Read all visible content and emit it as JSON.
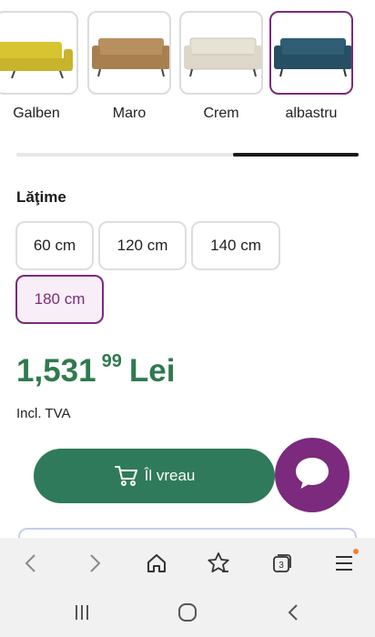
{
  "colors": {
    "accent": "#7b2a7d",
    "price_green": "#2f7a4f",
    "button_green": "#2f7a5a"
  },
  "color_options": [
    {
      "label": "Galben",
      "sofa_color": "#d8c431",
      "selected": false
    },
    {
      "label": "Maro",
      "sofa_color": "#b8905f",
      "selected": false
    },
    {
      "label": "Crem",
      "sofa_color": "#e6e2d6",
      "selected": false
    },
    {
      "label": "albastru",
      "sofa_color": "#2f5d75",
      "selected": true
    }
  ],
  "width_section": {
    "title": "Lăţime",
    "options": [
      "60 cm",
      "120 cm",
      "140 cm",
      "180 cm"
    ],
    "selected": "180 cm"
  },
  "price": {
    "main": "1,531",
    "cents": "99",
    "currency": "Lei",
    "vat_note": "Incl. TVA"
  },
  "buy_button": {
    "label": "Îl vreau",
    "icon": "cart-icon"
  },
  "chat_button": {
    "icon": "chat-bubble-icon"
  },
  "browser_toolbar": {
    "tabs_count": "3",
    "icons": [
      "back-icon",
      "forward-icon",
      "home-icon",
      "bookmark-star-icon",
      "tabs-icon",
      "menu-icon"
    ]
  },
  "system_nav": {
    "icons": [
      "recent-apps-icon",
      "home-circle-icon",
      "back-chevron-icon"
    ]
  }
}
